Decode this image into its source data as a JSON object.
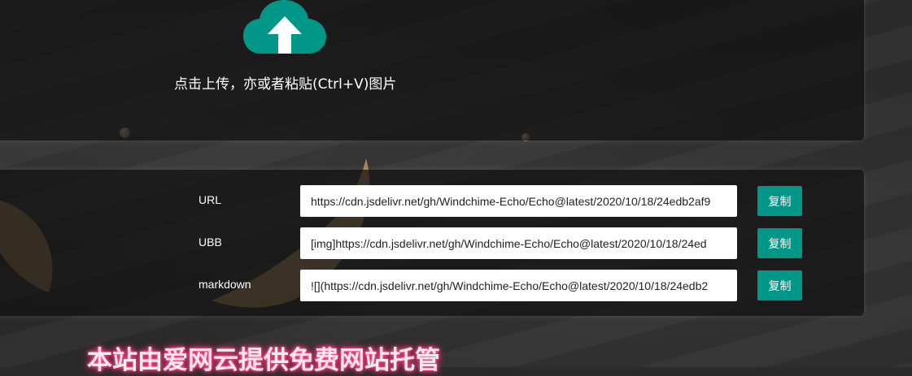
{
  "upload": {
    "hint": "点击上传，亦或者粘贴(Ctrl+V)图片",
    "icon": "cloud-upload-icon"
  },
  "links": [
    {
      "label": "URL",
      "value": "https://cdn.jsdelivr.net/gh/Windchime-Echo/Echo@latest/2020/10/18/24edb2af9",
      "button": "复制"
    },
    {
      "label": "UBB",
      "value": "[img]https://cdn.jsdelivr.net/gh/Windchime-Echo/Echo@latest/2020/10/18/24ed",
      "button": "复制"
    },
    {
      "label": "markdown",
      "value": "![](https://cdn.jsdelivr.net/gh/Windchime-Echo/Echo@latest/2020/10/18/24edb2",
      "button": "复制"
    }
  ],
  "footer": {
    "banner": "本站由爱网云提供免费网站托管"
  },
  "colors": {
    "accent": "#009688",
    "banner_glow": "#ff3d7f"
  }
}
